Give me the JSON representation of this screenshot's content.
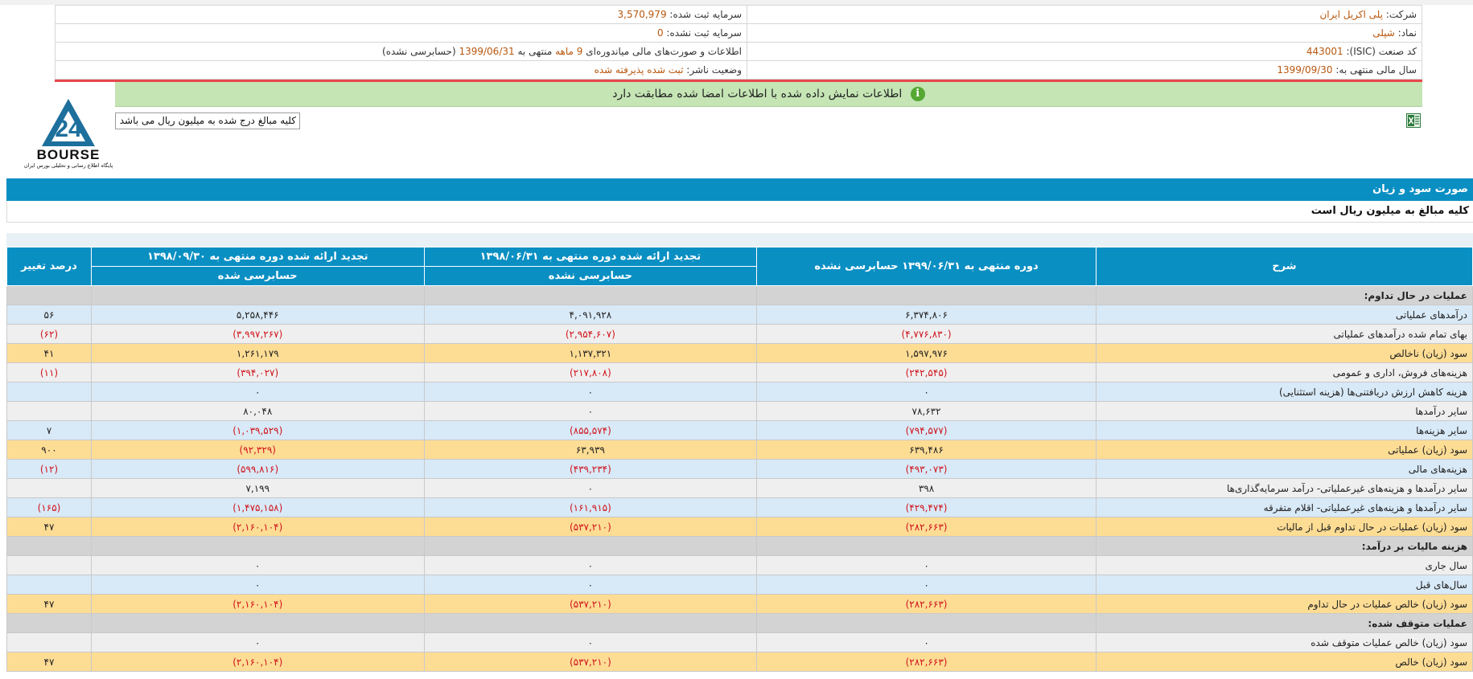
{
  "company": {
    "company_label": "شرکت:",
    "company_value": "پلی اکریل ایران",
    "symbol_label": "نماد:",
    "symbol_value": "شپلی",
    "isic_label": "کد صنعت (ISIC):",
    "isic_value": "443001",
    "fiscal_label": "سال مالی منتهی به:",
    "fiscal_value": "1399/09/30",
    "reg_capital_label": "سرمایه ثبت شده:",
    "reg_capital_value": "3,570,979",
    "unreg_capital_label": "سرمایه ثبت نشده:",
    "unreg_capital_value": "0",
    "statement_pre": "اطلاعات و صورت‌های مالی میاندوره‌ای",
    "statement_period": "9 ماهه",
    "statement_mid": "منتهی به",
    "statement_date": "1399/06/31",
    "statement_post": "(حسابرسی نشده)",
    "publisher_label": "وضعیت ناشر:",
    "publisher_value": "ثبت شده پذیرفته شده"
  },
  "notice": {
    "icon": "info-icon",
    "text": "اطلاعات نمایش داده شده با اطلاعات امضا شده مطابقت دارد"
  },
  "logo": {
    "text": "BOURSE",
    "subtext": "پایگاه اطلاع رسانی و تحلیلی بورس ایران",
    "number": "24"
  },
  "rial_note": "کلیه مبالغ درج شده به میلیون ریال می باشد",
  "excel_icon": "excel-export-icon",
  "section_title": "صورت سود و زیان",
  "section_subtitle": "کلیه مبالغ به میلیون ریال است",
  "table": {
    "headers": {
      "desc": "شرح",
      "current": "دوره منتهی به ۱۳۹۹/۰۶/۳۱ حسابرسی نشده",
      "restated_6m": "تجدید ارائه شده دوره منتهی به ۱۳۹۸/۰۶/۳۱",
      "restated_6m_sub": "حسابرسی نشده",
      "restated_fy": "تجدید ارائه شده دوره منتهی به ۱۳۹۸/۰۹/۳۰",
      "restated_fy_sub": "حسابرسی شده",
      "change": "درصد تغییر"
    },
    "rows": [
      {
        "type": "section",
        "desc": "عملیات در حال تداوم:",
        "c1": "",
        "c2": "",
        "c3": "",
        "c4": ""
      },
      {
        "type": "light",
        "desc": "درآمدهای عملیاتی",
        "c1": "۶,۳۷۴,۸۰۶",
        "c2": "۴,۰۹۱,۹۲۸",
        "c3": "۵,۲۵۸,۴۴۶",
        "c4": "۵۶"
      },
      {
        "type": "white",
        "desc": "بهای تمام شده درآمدهای عملیاتی",
        "c1": "(۴,۷۷۶,۸۳۰)",
        "c2": "(۲,۹۵۴,۶۰۷)",
        "c3": "(۳,۹۹۷,۲۶۷)",
        "c4": "(۶۲)"
      },
      {
        "type": "gold",
        "desc": "سود (زیان) ناخالص",
        "c1": "۱,۵۹۷,۹۷۶",
        "c2": "۱,۱۳۷,۳۲۱",
        "c3": "۱,۲۶۱,۱۷۹",
        "c4": "۴۱"
      },
      {
        "type": "white",
        "desc": "هزینه‌های فروش، اداری و عمومی",
        "c1": "(۲۴۲,۵۴۵)",
        "c2": "(۲۱۷,۸۰۸)",
        "c3": "(۳۹۴,۰۲۷)",
        "c4": "(۱۱)"
      },
      {
        "type": "light",
        "desc": "هزینه کاهش ارزش دریافتنی‌ها (هزینه استثنایی)",
        "c1": "۰",
        "c2": "۰",
        "c3": "۰",
        "c4": ""
      },
      {
        "type": "white",
        "desc": "سایر درآمدها",
        "c1": "۷۸,۶۳۲",
        "c2": "۰",
        "c3": "۸۰,۰۴۸",
        "c4": ""
      },
      {
        "type": "light",
        "desc": "سایر هزینه‌ها",
        "c1": "(۷۹۴,۵۷۷)",
        "c2": "(۸۵۵,۵۷۴)",
        "c3": "(۱,۰۳۹,۵۲۹)",
        "c4": "۷"
      },
      {
        "type": "gold",
        "desc": "سود (زیان) عملیاتی",
        "c1": "۶۳۹,۴۸۶",
        "c2": "۶۳,۹۳۹",
        "c3": "(۹۲,۳۲۹)",
        "c4": "۹۰۰"
      },
      {
        "type": "light",
        "desc": "هزینه‌های مالی",
        "c1": "(۴۹۳,۰۷۳)",
        "c2": "(۴۳۹,۲۳۴)",
        "c3": "(۵۹۹,۸۱۶)",
        "c4": "(۱۲)"
      },
      {
        "type": "white",
        "desc": "سایر درآمدها و هزینه‌های غیرعملیاتی- درآمد سرمایه‌گذاری‌ها",
        "c1": "۳۹۸",
        "c2": "۰",
        "c3": "۷,۱۹۹",
        "c4": ""
      },
      {
        "type": "light",
        "desc": "سایر درآمدها و هزینه‌های غیرعملیاتی- اقلام متفرقه",
        "c1": "(۴۲۹,۴۷۴)",
        "c2": "(۱۶۱,۹۱۵)",
        "c3": "(۱,۴۷۵,۱۵۸)",
        "c4": "(۱۶۵)"
      },
      {
        "type": "gold",
        "desc": "سود (زیان) عملیات در حال تداوم قبل از مالیات",
        "c1": "(۲۸۲,۶۶۳)",
        "c2": "(۵۳۷,۲۱۰)",
        "c3": "(۲,۱۶۰,۱۰۴)",
        "c4": "۴۷"
      },
      {
        "type": "section",
        "desc": "هزینه مالیات بر درآمد:",
        "c1": "",
        "c2": "",
        "c3": "",
        "c4": ""
      },
      {
        "type": "white",
        "desc": "سال جاری",
        "c1": "۰",
        "c2": "۰",
        "c3": "۰",
        "c4": ""
      },
      {
        "type": "light",
        "desc": "سال‌های قبل",
        "c1": "۰",
        "c2": "۰",
        "c3": "۰",
        "c4": ""
      },
      {
        "type": "gold",
        "desc": "سود (زیان) خالص عملیات در حال تداوم",
        "c1": "(۲۸۲,۶۶۳)",
        "c2": "(۵۳۷,۲۱۰)",
        "c3": "(۲,۱۶۰,۱۰۴)",
        "c4": "۴۷"
      },
      {
        "type": "section",
        "desc": "عملیات متوقف شده:",
        "c1": "",
        "c2": "",
        "c3": "",
        "c4": ""
      },
      {
        "type": "white",
        "desc": "سود (زیان) خالص عملیات متوقف شده",
        "c1": "۰",
        "c2": "۰",
        "c3": "۰",
        "c4": ""
      },
      {
        "type": "gold",
        "desc": "سود (زیان) خالص",
        "c1": "(۲۸۲,۶۶۳)",
        "c2": "(۵۳۷,۲۱۰)",
        "c3": "(۲,۱۶۰,۱۰۴)",
        "c4": "۴۷"
      }
    ]
  }
}
